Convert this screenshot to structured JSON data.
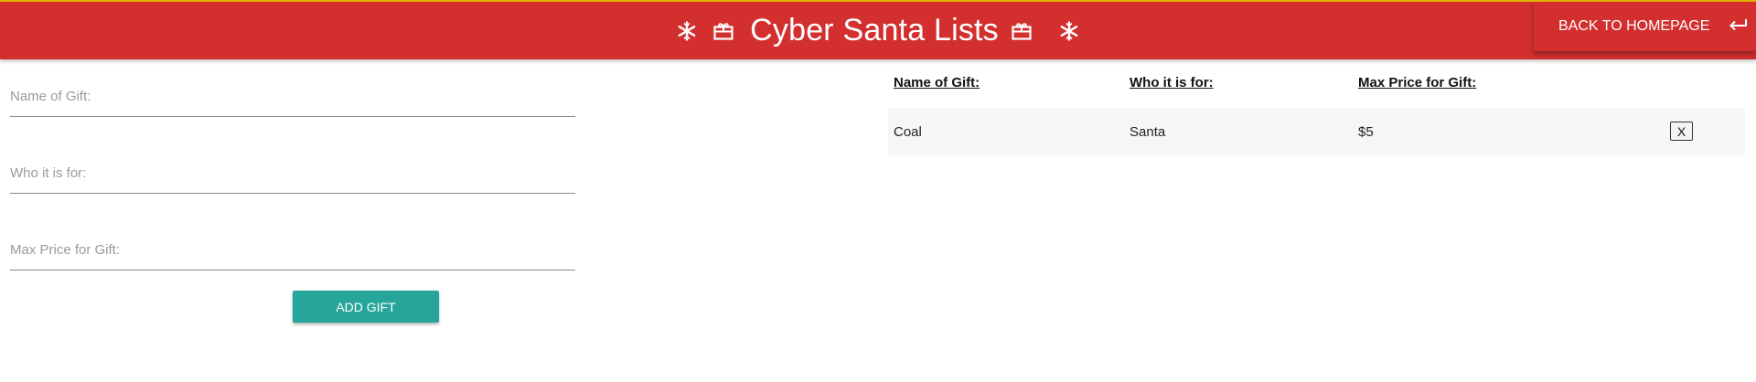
{
  "header": {
    "title": "Cyber Santa Lists",
    "back_button_label": "BACK TO HOMEPAGE",
    "bar_color": "#d32f2f",
    "icons": [
      "snowflake-icon",
      "gift-icon",
      "gift-icon",
      "snowflake-icon",
      "return-arrow-icon"
    ]
  },
  "form": {
    "gift_name_placeholder": "Name of Gift:",
    "recipient_placeholder": "Who it is for:",
    "max_price_placeholder": "Max Price for Gift:",
    "add_button_label": "ADD GIFT",
    "add_button_color": "#26a69a"
  },
  "table": {
    "headers": [
      "Name of Gift:",
      "Who it is for:",
      "Max Price for Gift:"
    ],
    "rows": [
      {
        "gift": "Coal",
        "recipient": "Santa",
        "max_price": "$5",
        "delete_label": "X"
      }
    ]
  }
}
